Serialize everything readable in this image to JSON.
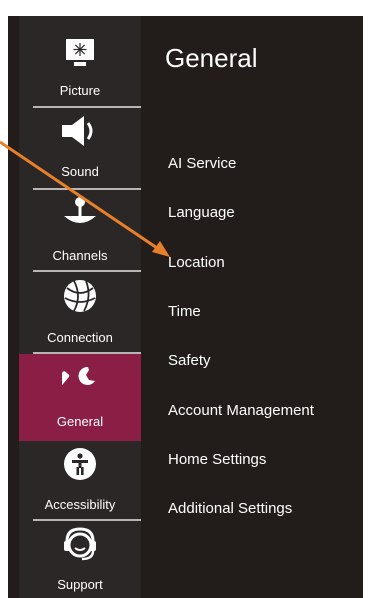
{
  "colors": {
    "accent": "#8b1e45",
    "annotation_arrow": "#e8802a",
    "panel_bg": "#221c1a",
    "sidebar_bg": "#2b2726"
  },
  "sidebar": {
    "items": [
      {
        "label": "Picture",
        "icon": "picture-icon"
      },
      {
        "label": "Sound",
        "icon": "speaker-icon"
      },
      {
        "label": "Channels",
        "icon": "satellite-dish-icon"
      },
      {
        "label": "Connection",
        "icon": "globe-icon"
      },
      {
        "label": "General",
        "icon": "wrench-icon",
        "selected": true
      },
      {
        "label": "Accessibility",
        "icon": "accessibility-icon"
      },
      {
        "label": "Support",
        "icon": "headset-icon"
      }
    ]
  },
  "content": {
    "title": "General",
    "items": [
      "AI Service",
      "Language",
      "Location",
      "Time",
      "Safety",
      "Account Management",
      "Home Settings",
      "Additional Settings"
    ]
  }
}
